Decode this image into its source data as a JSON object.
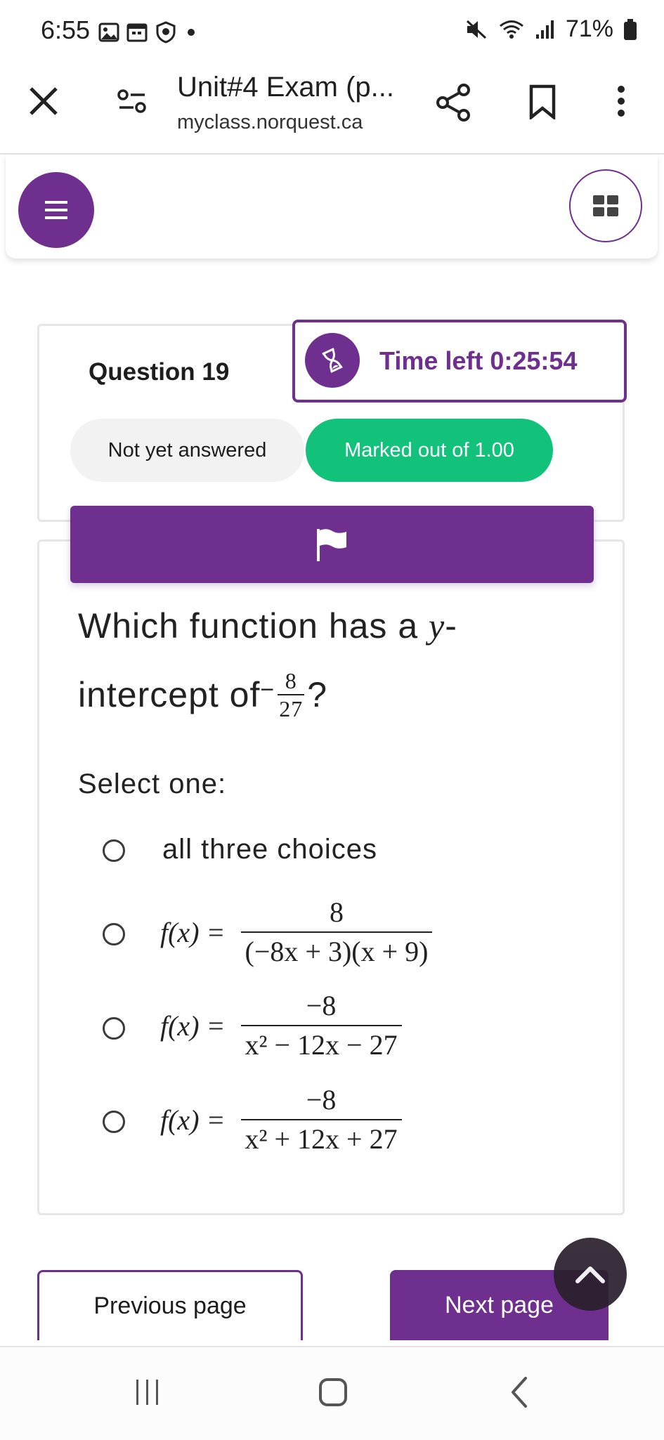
{
  "status_bar": {
    "time": "6:55",
    "battery": "71%",
    "left_icons": [
      "image-icon",
      "calendar-icon",
      "shield-icon",
      "dot-icon"
    ],
    "right_icons": [
      "mute-icon",
      "wifi-icon",
      "signal-icon",
      "battery-icon"
    ]
  },
  "browser": {
    "title": "Unit#4 Exam (p...",
    "domain": "myclass.norquest.ca",
    "icons": [
      "close-icon",
      "site-settings-icon",
      "share-icon",
      "bookmark-icon",
      "more-icon"
    ]
  },
  "header": {
    "menu_icon": "hamburger-icon",
    "grid_icon": "grid-icon"
  },
  "question_info": {
    "title": "Question 19",
    "timer": "Time left 0:25:54",
    "status": "Not yet answered",
    "marks": "Marked out of 1.00"
  },
  "question": {
    "text_1": "Which function has a ",
    "text_var": "y",
    "text_dash": "-",
    "text_2": "intercept of ",
    "minus": "−",
    "frac_num": "8",
    "frac_den": "27",
    "qmark": "?",
    "select_one": "Select one:",
    "options": [
      {
        "text": "all three choices"
      },
      {
        "lhs": "f(x) =",
        "num": "8",
        "den": "(−8x + 3)(x + 9)"
      },
      {
        "lhs": "f(x) =",
        "num": "−8",
        "den": "x² − 12x − 27"
      },
      {
        "lhs": "f(x) =",
        "num": "−8",
        "den": "x² + 12x + 27"
      }
    ]
  },
  "navigation": {
    "previous": "Previous page",
    "next": "Next page"
  },
  "colors": {
    "primary": "#6f2f8f",
    "success": "#12c27a",
    "badge_bg": "#f2f2f2"
  }
}
